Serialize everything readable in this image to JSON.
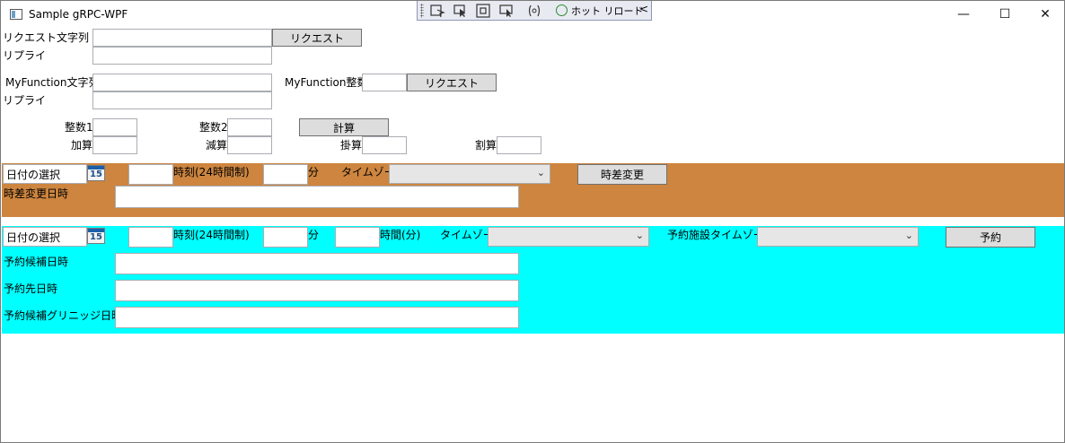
{
  "window": {
    "title": "Sample gRPC-WPF",
    "minimize": "—",
    "maximize": "☐",
    "close": "✕"
  },
  "devbar": {
    "hot_reload": "ホット リロード",
    "collapse": "<"
  },
  "request": {
    "label": "リクエスト文字列",
    "value": "",
    "button": "リクエスト",
    "reply_label": "リプライ",
    "reply_value": ""
  },
  "myfunction": {
    "string_label": "MyFunction文字列",
    "string_value": "",
    "int_label": "MyFunction整数",
    "int_value": "",
    "button": "リクエスト",
    "reply_label": "リプライ",
    "reply_value": ""
  },
  "calc": {
    "int1_label": "整数1",
    "int2_label": "整数2",
    "button": "計算",
    "add_label": "加算",
    "sub_label": "減算",
    "mul_label": "掛算",
    "div_label": "割算"
  },
  "timediff": {
    "date_placeholder": "日付の選択",
    "calendar_num": "15",
    "time_label": "時刻(24時間制)",
    "minute_label": "分",
    "tz_label": "タイムゾーン",
    "tz_value": "",
    "button": "時差変更",
    "result_label": "時差変更日時",
    "result_value": "",
    "bg": "#cd853f"
  },
  "reserve": {
    "date_placeholder": "日付の選択",
    "calendar_num": "15",
    "time_label": "時刻(24時間制)",
    "minute_label": "分",
    "duration_label": "時間(分)",
    "tz_label": "タイムゾーン",
    "tz_value": "",
    "facility_tz_label": "予約施設タイムゾーン",
    "facility_tz_value": "",
    "button": "予約",
    "candidate_label": "予約候補日時",
    "target_label": "予約先日時",
    "candidate_gmt_label": "予約候補グリニッジ日時",
    "bg": "#00ffff"
  }
}
